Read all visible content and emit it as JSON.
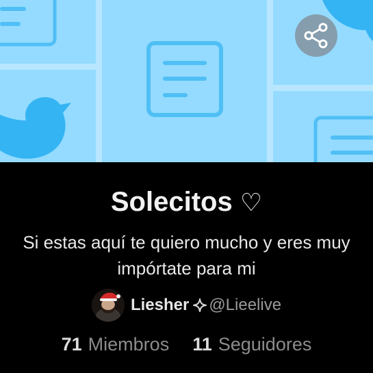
{
  "community": {
    "name": "Solecitos",
    "name_symbol": "♡",
    "description_lines": [
      "Si estas aquí te quiero mucho y eres muy",
      "impórtate para mi"
    ]
  },
  "author": {
    "name": "Liesher",
    "handle": "@Lieelive",
    "badge_icon": "sparkle-icon"
  },
  "stats": {
    "members_count": "71",
    "members_label": "Miembros",
    "followers_count": "11",
    "followers_label": "Seguidores"
  },
  "share": {
    "icon": "share-icon"
  },
  "colors": {
    "banner_bg": "#94dbff",
    "banner_card": "#bfe9ff",
    "banner_accent": "#35b4f3",
    "background": "#000000",
    "muted_text": "#8c8c8c"
  }
}
